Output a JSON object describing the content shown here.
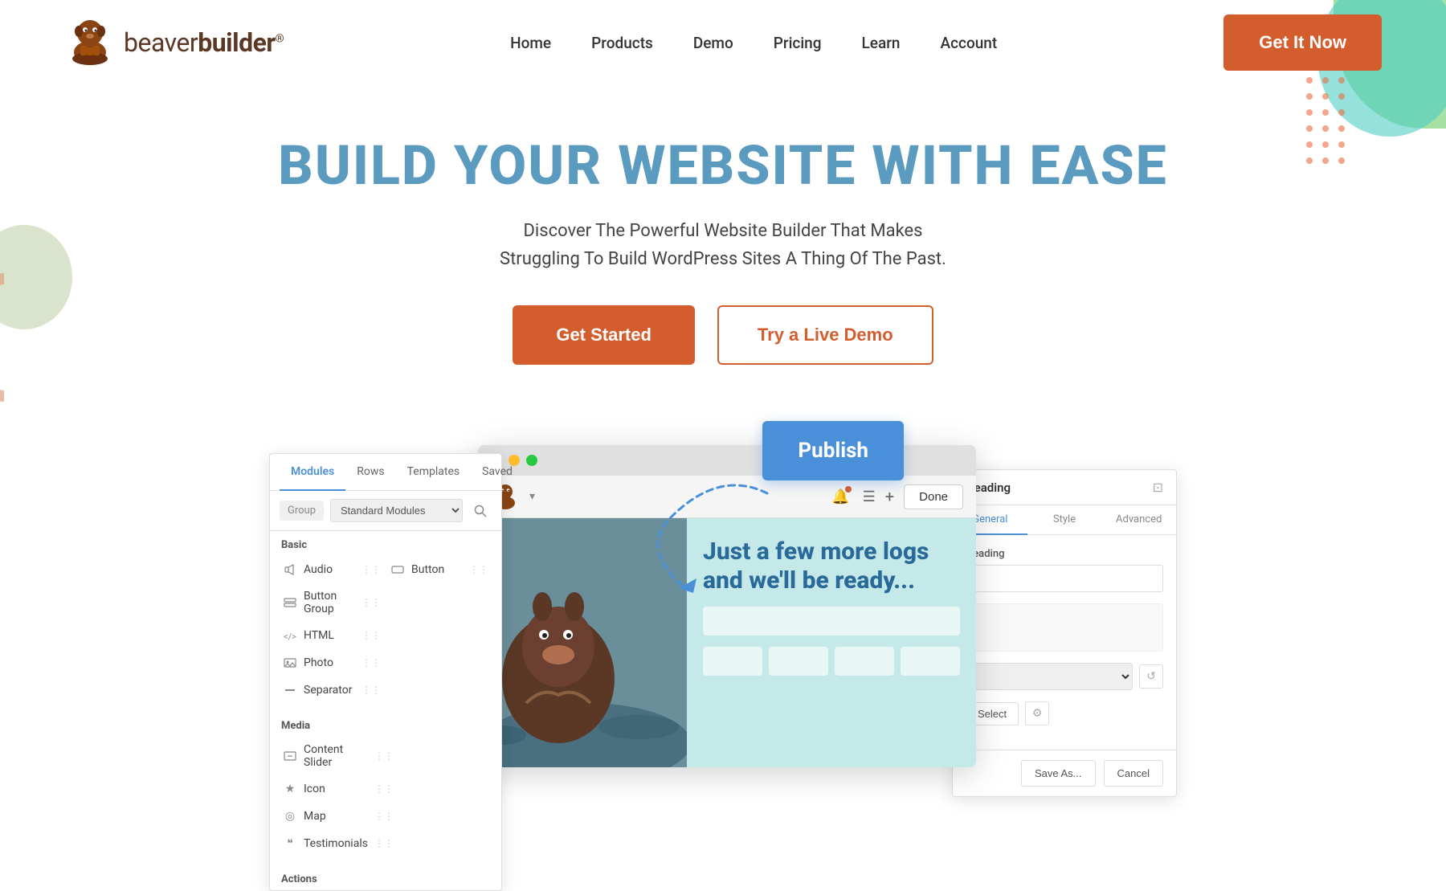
{
  "nav": {
    "logo_text_light": "beaver",
    "logo_text_bold": "builder",
    "logo_tm": "®",
    "links": [
      {
        "label": "Home",
        "id": "home"
      },
      {
        "label": "Products",
        "id": "products"
      },
      {
        "label": "Demo",
        "id": "demo"
      },
      {
        "label": "Pricing",
        "id": "pricing"
      },
      {
        "label": "Learn",
        "id": "learn"
      },
      {
        "label": "Account",
        "id": "account"
      }
    ],
    "cta_label": "Get It Now"
  },
  "hero": {
    "headline": "BUILD YOUR WEBSITE WITH EASE",
    "subtitle_line1": "Discover The Powerful Website Builder That Makes",
    "subtitle_line2": "Struggling To Build WordPress Sites A Thing Of The Past.",
    "btn_start": "Get Started",
    "btn_demo": "Try a Live Demo"
  },
  "modules_panel": {
    "tabs": [
      "Modules",
      "Rows",
      "Templates",
      "Saved"
    ],
    "active_tab": "Modules",
    "filter_label": "Group",
    "filter_value": "Standard Modules",
    "section_basic": "Basic",
    "section_media": "Media",
    "section_actions": "Actions",
    "items_basic": [
      {
        "label": "Audio",
        "icon": "♪"
      },
      {
        "label": "Button",
        "icon": "▭"
      },
      {
        "label": "Button Group",
        "icon": "≡"
      },
      {
        "label": "",
        "icon": ""
      },
      {
        "label": "HTML",
        "icon": "<>"
      },
      {
        "label": "",
        "icon": ""
      },
      {
        "label": "Photo",
        "icon": "▭"
      },
      {
        "label": "",
        "icon": ""
      },
      {
        "label": "Separator",
        "icon": "—"
      },
      {
        "label": "",
        "icon": ""
      }
    ],
    "items_media": [
      {
        "label": "Content Slider",
        "icon": "▭"
      },
      {
        "label": "",
        "icon": ""
      },
      {
        "label": "Icon",
        "icon": "★"
      },
      {
        "label": "",
        "icon": ""
      },
      {
        "label": "Map",
        "icon": "◎"
      },
      {
        "label": "",
        "icon": ""
      },
      {
        "label": "Testimonials",
        "icon": "❝"
      },
      {
        "label": "",
        "icon": ""
      }
    ]
  },
  "app_window": {
    "toolbar": {
      "done_label": "Done"
    },
    "tagline_line1": "Just a few more logs",
    "tagline_line2": "and we'll be ready..."
  },
  "publish_btn": "Publish",
  "heading_panel": {
    "title": "Heading",
    "tabs": [
      "General",
      "Style",
      "Advanced"
    ],
    "active_tab": "General",
    "field_label": "Heading",
    "select_label": "Select",
    "save_as_label": "Save As...",
    "cancel_label": "Cancel"
  }
}
